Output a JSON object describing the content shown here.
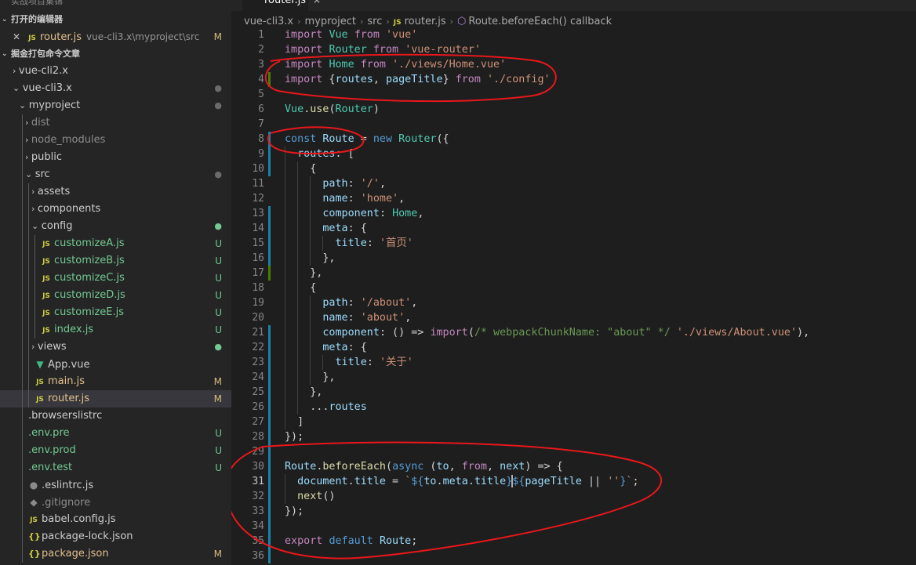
{
  "explorer": {
    "top_title": "实战项目集锦",
    "open_editors_header": "打开的编辑器",
    "open_editor": {
      "name": "router.js",
      "path": "vue-cli3.x\\myproject\\src",
      "badge": "M"
    },
    "workspace_header": "掘金打包命令文章",
    "tree": [
      {
        "label": "vue-cli2.x",
        "type": "folder",
        "open": false,
        "badge": ""
      },
      {
        "label": "vue-cli3.x",
        "type": "folder",
        "open": true,
        "badge": "dot"
      },
      {
        "label": "myproject",
        "type": "folder",
        "open": true,
        "badge": "dot"
      },
      {
        "label": "dist",
        "type": "folder",
        "open": false,
        "badge": ""
      },
      {
        "label": "node_modules",
        "type": "folder",
        "open": false,
        "badge": ""
      },
      {
        "label": "public",
        "type": "folder",
        "open": false,
        "badge": ""
      },
      {
        "label": "src",
        "type": "folder",
        "open": true,
        "badge": "dot"
      },
      {
        "label": "assets",
        "type": "folder",
        "open": false,
        "badge": ""
      },
      {
        "label": "components",
        "type": "folder",
        "open": false,
        "badge": ""
      },
      {
        "label": "config",
        "type": "folder",
        "open": true,
        "badge": "dotg"
      },
      {
        "label": "customizeA.js",
        "type": "js",
        "badge": "U"
      },
      {
        "label": "customizeB.js",
        "type": "js",
        "badge": "U"
      },
      {
        "label": "customizeC.js",
        "type": "js",
        "badge": "U"
      },
      {
        "label": "customizeD.js",
        "type": "js",
        "badge": "U"
      },
      {
        "label": "customizeE.js",
        "type": "js",
        "badge": "U"
      },
      {
        "label": "index.js",
        "type": "js",
        "badge": "U"
      },
      {
        "label": "views",
        "type": "folder",
        "open": false,
        "badge": "dotg"
      },
      {
        "label": "App.vue",
        "type": "vue",
        "badge": ""
      },
      {
        "label": "main.js",
        "type": "js",
        "badge": "M"
      },
      {
        "label": "router.js",
        "type": "js",
        "badge": "M",
        "selected": true
      },
      {
        "label": ".browserslistrc",
        "type": "plain",
        "badge": ""
      },
      {
        "label": ".env.pre",
        "type": "plain",
        "badge": "U"
      },
      {
        "label": ".env.prod",
        "type": "plain",
        "badge": "U"
      },
      {
        "label": ".env.test",
        "type": "plain",
        "badge": "U"
      },
      {
        "label": ".eslintrc.js",
        "type": "gear",
        "badge": ""
      },
      {
        "label": ".gitignore",
        "type": "git",
        "badge": ""
      },
      {
        "label": "babel.config.js",
        "type": "js",
        "badge": ""
      },
      {
        "label": "package-lock.json",
        "type": "json",
        "badge": ""
      },
      {
        "label": "package.json",
        "type": "json",
        "badge": "M"
      }
    ]
  },
  "editor": {
    "tab_label": "router.js",
    "breadcrumb": [
      "vue-cli3.x",
      "myproject",
      "src",
      "router.js",
      "Route.beforeEach() callback"
    ],
    "current_line": 31,
    "lines": [
      {
        "n": 1,
        "code": "import Vue from 'vue'"
      },
      {
        "n": 2,
        "code": "import Router from 'vue-router'"
      },
      {
        "n": 3,
        "code": "import Home from './views/Home.vue'"
      },
      {
        "n": 4,
        "code": "import {routes, pageTitle} from './config'"
      },
      {
        "n": 5,
        "code": ""
      },
      {
        "n": 6,
        "code": "Vue.use(Router)"
      },
      {
        "n": 7,
        "code": ""
      },
      {
        "n": 8,
        "code": "const Route = new Router({"
      },
      {
        "n": 9,
        "code": "  routes: ["
      },
      {
        "n": 10,
        "code": "    {"
      },
      {
        "n": 11,
        "code": "      path: '/',"
      },
      {
        "n": 12,
        "code": "      name: 'home',"
      },
      {
        "n": 13,
        "code": "      component: Home,"
      },
      {
        "n": 14,
        "code": "      meta: {"
      },
      {
        "n": 15,
        "code": "        title: '首页'"
      },
      {
        "n": 16,
        "code": "      },"
      },
      {
        "n": 17,
        "code": "    },"
      },
      {
        "n": 18,
        "code": "    {"
      },
      {
        "n": 19,
        "code": "      path: '/about',"
      },
      {
        "n": 20,
        "code": "      name: 'about',"
      },
      {
        "n": 21,
        "code": "      component: () => import(/* webpackChunkName: \"about\" */ './views/About.vue'),"
      },
      {
        "n": 22,
        "code": "      meta: {"
      },
      {
        "n": 23,
        "code": "        title: '关于'"
      },
      {
        "n": 24,
        "code": "      },"
      },
      {
        "n": 25,
        "code": "    },"
      },
      {
        "n": 26,
        "code": "    ...routes"
      },
      {
        "n": 27,
        "code": "  ]"
      },
      {
        "n": 28,
        "code": "});"
      },
      {
        "n": 29,
        "code": ""
      },
      {
        "n": 30,
        "code": "Route.beforeEach(async (to, from, next) => {"
      },
      {
        "n": 31,
        "code": "  document.title = `${to.meta.title}${pageTitle || ''}`;"
      },
      {
        "n": 32,
        "code": "  next()"
      },
      {
        "n": 33,
        "code": "});"
      },
      {
        "n": 34,
        "code": ""
      },
      {
        "n": 35,
        "code": "export default Route;"
      },
      {
        "n": 36,
        "code": ""
      }
    ]
  },
  "colors": {
    "sidebar_bg": "#252526",
    "editor_bg": "#1e1e1e",
    "modified": "#e2c08d",
    "untracked": "#73c991",
    "annotation": "#e8171c"
  }
}
